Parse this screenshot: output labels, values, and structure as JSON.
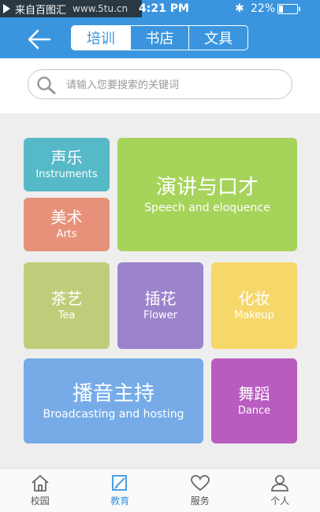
{
  "status": {
    "watermark_text": "来自百图汇",
    "watermark_site": "www.5tu.cn",
    "time": "4:21 PM",
    "battery": "22%",
    "battery_level": 0.22
  },
  "header": {
    "back_icon": "arrow-left-icon",
    "segments": [
      "培训",
      "书店",
      "文具"
    ],
    "active_segment": 0
  },
  "search": {
    "placeholder": "请输入您要搜索的关键词",
    "icon": "search-icon"
  },
  "categories": [
    {
      "zh": "声乐",
      "en": "Instruments",
      "color": "#56b9c7"
    },
    {
      "zh": "美术",
      "en": "Arts",
      "color": "#e7917a"
    },
    {
      "zh": "演讲与口才",
      "en": "Speech and eloquence",
      "color": "#a6d35a"
    },
    {
      "zh": "茶艺",
      "en": "Tea",
      "color": "#bfcd7a"
    },
    {
      "zh": "插花",
      "en": "Flower",
      "color": "#9b84cc"
    },
    {
      "zh": "化妆",
      "en": "Makeup",
      "color": "#f6d76a"
    },
    {
      "zh": "播音主持",
      "en": "Broadcasting and hosting",
      "color": "#76abe8"
    },
    {
      "zh": "舞蹈",
      "en": "Dance",
      "color": "#b95cc0"
    }
  ],
  "tabbar": {
    "items": [
      {
        "label": "校园",
        "icon": "home-icon"
      },
      {
        "label": "教育",
        "icon": "edit-icon"
      },
      {
        "label": "服务",
        "icon": "heart-icon"
      },
      {
        "label": "个人",
        "icon": "person-icon"
      }
    ],
    "active": 1
  }
}
